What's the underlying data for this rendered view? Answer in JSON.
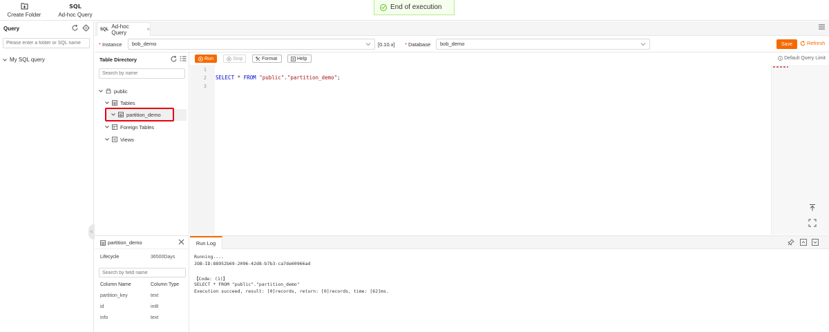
{
  "toolbar": {
    "create_folder": "Create Folder",
    "adhoc_icon_text": "SQL",
    "adhoc_query": "Ad-hoc Query"
  },
  "toast": {
    "message": "End of execution"
  },
  "left_panel": {
    "title": "Query",
    "search_placeholder": "Please enter a folder or SQL name",
    "tree_item": "My SQL query"
  },
  "tabs": [
    {
      "icon_text": "SQL",
      "label": "Ad-hoc Query"
    }
  ],
  "connection": {
    "instance_label": "Instance",
    "instance_value": "bob_demo",
    "version": "[0.10.x]",
    "database_label": "Database",
    "database_value": "bob_demo",
    "save": "Save",
    "refresh": "Refresh"
  },
  "table_directory": {
    "title": "Table Directory",
    "search_placeholder": "Search by name",
    "tree": {
      "schema": "public",
      "tables": "Tables",
      "selected_table": "partition_demo",
      "foreign_tables": "Foreign Tables",
      "views": "Views"
    }
  },
  "editor": {
    "run": "Run",
    "stop": "Stop",
    "format": "Format",
    "help": "Help",
    "query_limit": "Default Query Limit",
    "line_numbers": [
      "1",
      "2",
      "3"
    ],
    "sql": {
      "kw1": "SELECT",
      "star": " * ",
      "kw2": "FROM",
      "str1": "\"public\"",
      "dot": ".",
      "str2": "\"partition_demo\"",
      "end": ";"
    }
  },
  "table_detail": {
    "name": "partition_demo",
    "lifecycle_label": "Lifecycle",
    "lifecycle_value": "36500Days",
    "search_placeholder": "Search by field name",
    "col_name_header": "Column Name",
    "col_type_header": "Column Type",
    "columns": [
      {
        "name": "partition_key",
        "type": "text"
      },
      {
        "name": "id",
        "type": "int8"
      },
      {
        "name": "info",
        "type": "text"
      }
    ]
  },
  "run_log": {
    "tab": "Run Log",
    "lines": [
      "Running....",
      "JOB-ID:88952b69-2096-42d8-b7b3-ca7de60966ad",
      "",
      "【Code: (1)】",
      "SELECT * FROM \"public\".\"partition_demo\"",
      "Execution succeed, result: [0]records, return: [0]records, time: [62]ms."
    ]
  },
  "colors": {
    "accent": "#f56a00",
    "highlight": "#e60012",
    "success": "#52c41a"
  }
}
